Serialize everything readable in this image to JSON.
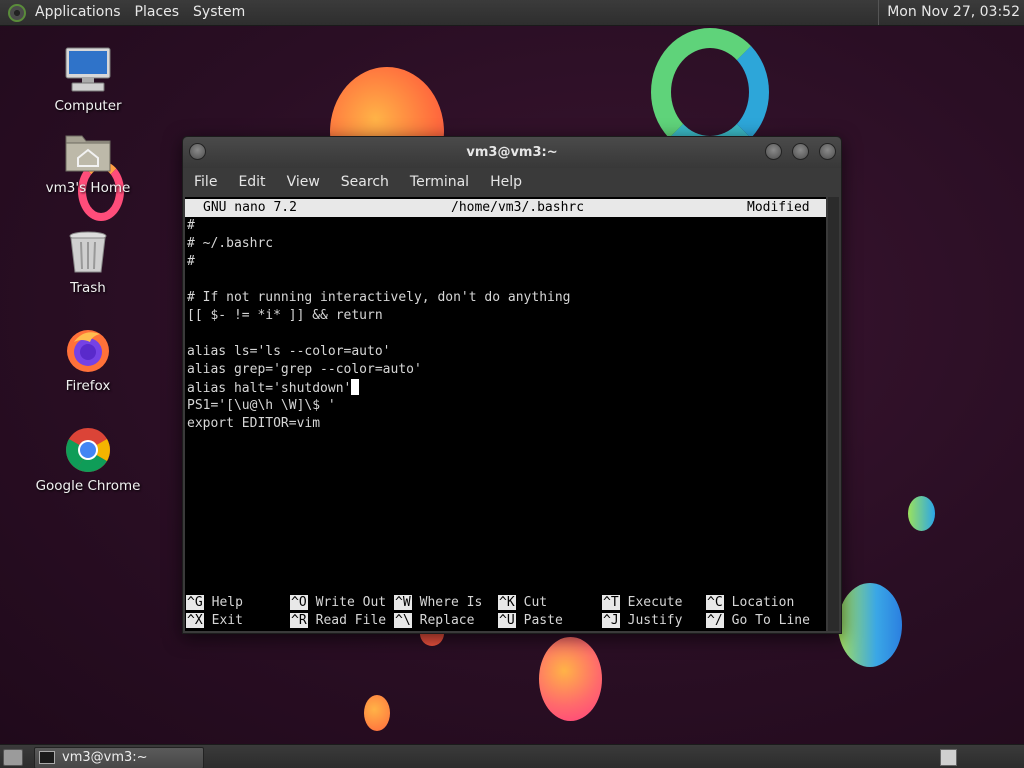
{
  "top_panel": {
    "menus": [
      "Applications",
      "Places",
      "System"
    ],
    "clock": "Mon Nov 27, 03:52"
  },
  "desktop_icons": [
    {
      "label": "Computer",
      "icon": "computer-icon"
    },
    {
      "label": "vm3's Home",
      "icon": "home-folder-icon"
    },
    {
      "label": "Trash",
      "icon": "trash-icon"
    },
    {
      "label": "Firefox",
      "icon": "firefox-icon"
    },
    {
      "label": "Google Chrome",
      "icon": "chrome-icon"
    }
  ],
  "terminal": {
    "title": "vm3@vm3:~",
    "menus": [
      "File",
      "Edit",
      "View",
      "Search",
      "Terminal",
      "Help"
    ]
  },
  "nano": {
    "version": "GNU nano 7.2",
    "file_path": "/home/vm3/.bashrc",
    "status": "Modified",
    "lines": [
      "#",
      "# ~/.bashrc",
      "#",
      "",
      "# If not running interactively, don't do anything",
      "[[ $- != *i* ]] && return",
      "",
      "alias ls='ls --color=auto'",
      "alias grep='grep --color=auto'",
      "alias halt='shutdown'",
      "PS1='[\\u@\\h \\W]\\$ '",
      "export EDITOR=vim"
    ],
    "cursor_line": 9,
    "shortcuts_row1": [
      {
        "key": "^G",
        "label": "Help"
      },
      {
        "key": "^O",
        "label": "Write Out"
      },
      {
        "key": "^W",
        "label": "Where Is"
      },
      {
        "key": "^K",
        "label": "Cut"
      },
      {
        "key": "^T",
        "label": "Execute"
      },
      {
        "key": "^C",
        "label": "Location"
      }
    ],
    "shortcuts_row2": [
      {
        "key": "^X",
        "label": "Exit"
      },
      {
        "key": "^R",
        "label": "Read File"
      },
      {
        "key": "^\\",
        "label": "Replace"
      },
      {
        "key": "^U",
        "label": "Paste"
      },
      {
        "key": "^J",
        "label": "Justify"
      },
      {
        "key": "^/",
        "label": "Go To Line"
      }
    ]
  },
  "taskbar": {
    "window_label": "vm3@vm3:~"
  },
  "colors": {
    "desktop_bg": "#2a0e24",
    "panel_bg": "#333333",
    "terminal_bg": "#000000",
    "nano_bar": "#e8e8e8"
  }
}
